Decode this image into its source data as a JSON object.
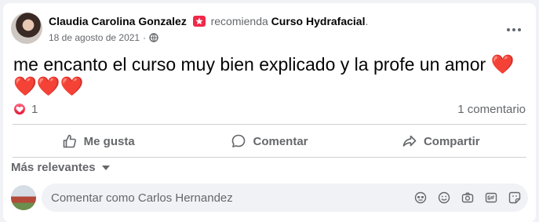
{
  "post": {
    "author": "Claudia Carolina Gonzalez",
    "recommends": "recomienda",
    "page": "Curso Hydrafacial",
    "page_suffix": ".",
    "date": "18 de agosto de 2021",
    "separator": "·",
    "text": "me encanto el curso muy bien explicado y la profe un amor",
    "hearts_inline": "❤️",
    "hearts_second_line": "❤️❤️❤️"
  },
  "stats": {
    "reaction_count": "1",
    "comments": "1 comentario"
  },
  "actions": {
    "like": "Me gusta",
    "comment": "Comentar",
    "share": "Compartir"
  },
  "sort": {
    "label": "Más relevantes"
  },
  "composer": {
    "placeholder": "Comentar como Carlos Hernandez"
  },
  "colors": {
    "badge": "#f02849",
    "text_secondary": "#65676b",
    "heart": "#e41e3f"
  }
}
